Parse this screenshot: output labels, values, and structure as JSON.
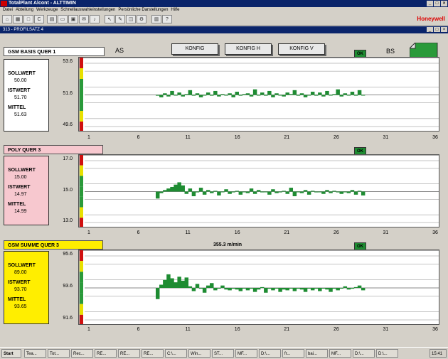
{
  "window": {
    "title": "TotalPlant Alcont - ALTTIMIN",
    "brand": "Honeywell"
  },
  "menu": [
    "Datei",
    "Abteilung",
    "Werkzeuge",
    "Schnellauswahleinstellungen",
    "Persönliche Darstellungen",
    "Hilfe"
  ],
  "subwindow": {
    "title": "313 - PROFILSATZ 4"
  },
  "header": {
    "as": "AS",
    "bs": "BS",
    "konfig": "KONFIG",
    "konfig_h": "KONFIG H",
    "konfig_v": "KONFIG V"
  },
  "panels": [
    {
      "title": "GSM BASIS QUER  1",
      "sollwert_label": "SOLLWERT",
      "sollwert": "50.00",
      "istwert_label": "ISTWERT",
      "istwert": "51.70",
      "mittel_label": "MITTEL",
      "mittel": "51.63",
      "ok": "OK",
      "y_top": "53.6",
      "y_mid": "51.6",
      "y_bot": "49.6",
      "x_ticks": [
        "1",
        "6",
        "11",
        "16",
        "21",
        "26",
        "31",
        "36"
      ],
      "center": 51.6,
      "half_range": 2.0,
      "values": [
        51.55,
        51.45,
        51.7,
        51.5,
        51.85,
        51.6,
        51.75,
        51.5,
        51.65,
        51.9,
        51.55,
        51.7,
        51.45,
        51.6,
        51.75,
        51.55,
        51.85,
        51.5,
        51.65,
        51.6,
        51.7,
        51.45,
        51.8,
        51.55,
        51.65,
        51.7,
        51.5,
        51.95,
        51.6,
        51.75,
        51.55,
        51.85,
        51.45,
        51.7,
        51.6,
        51.5,
        51.75,
        51.65,
        51.9,
        51.55,
        51.7,
        51.45,
        51.6,
        51.8,
        51.55,
        51.75,
        51.5,
        51.85,
        51.6,
        51.65,
        51.95,
        51.5,
        51.7,
        51.6,
        51.8,
        51.55,
        51.9,
        51.6
      ]
    },
    {
      "title": "POLY    QUER  3",
      "sollwert_label": "SOLLWERT",
      "sollwert": "15.00",
      "istwert_label": "ISTWERT",
      "istwert": "14.97",
      "mittel_label": "MITTEL",
      "mittel": "14.99",
      "ok": "OK",
      "y_top": "17.0",
      "y_mid": "15.0",
      "y_bot": "13.0",
      "x_ticks": [
        "1",
        "6",
        "11",
        "16",
        "21",
        "26",
        "31",
        "36"
      ],
      "center": 15.0,
      "half_range": 2.0,
      "values": [
        14.55,
        14.9,
        15.1,
        15.2,
        15.3,
        15.45,
        15.6,
        15.4,
        14.85,
        15.2,
        14.7,
        14.95,
        15.25,
        14.8,
        15.1,
        14.9,
        15.05,
        14.75,
        15.0,
        15.15,
        14.85,
        14.95,
        15.05,
        14.8,
        15.0,
        14.9,
        15.2,
        14.85,
        15.1,
        14.95,
        15.0,
        14.8,
        15.15,
        14.9,
        14.95,
        15.05,
        14.85,
        15.25,
        14.7,
        15.0,
        14.9,
        15.1,
        14.8,
        15.05,
        14.95,
        15.0,
        14.85,
        15.1,
        14.9,
        15.05,
        14.95,
        14.85,
        15.0,
        14.9,
        15.1,
        14.8,
        15.05,
        14.75
      ]
    },
    {
      "title": "GSM SUMME QUER  3",
      "sollwert_label": "SOLLWERT",
      "sollwert": "89.00",
      "istwert_label": "ISTWERT",
      "istwert": "93.70",
      "mittel_label": "MITTEL",
      "mittel": "93.65",
      "ok": "OK",
      "speed": "355.3 m/min",
      "y_top": "95.6",
      "y_mid": "93.6",
      "y_bot": "91.6",
      "x_ticks": [
        "1",
        "6",
        "11",
        "16",
        "21",
        "26",
        "31",
        "36"
      ],
      "center": 93.6,
      "half_range": 2.0,
      "values": [
        92.9,
        93.8,
        94.1,
        94.45,
        94.2,
        93.95,
        94.3,
        94.05,
        94.25,
        93.7,
        93.4,
        93.85,
        93.55,
        93.3,
        93.75,
        93.9,
        93.45,
        93.6,
        93.75,
        93.5,
        93.45,
        93.55,
        93.5,
        93.4,
        93.6,
        93.45,
        93.55,
        93.35,
        93.5,
        93.65,
        93.3,
        93.55,
        93.45,
        93.6,
        93.35,
        93.5,
        93.45,
        93.6,
        93.4,
        93.55,
        93.5,
        93.35,
        93.6,
        93.45,
        93.55,
        93.4,
        93.6,
        93.5,
        93.35,
        93.55,
        93.45,
        93.6,
        93.7,
        93.5,
        93.55,
        93.65,
        93.75,
        93.45
      ]
    }
  ],
  "taskbar": {
    "start": "Start",
    "items": [
      "Tea...",
      "Tot...",
      "Rec...",
      "RE...",
      "RE...",
      "RE...",
      "C:\\...",
      "Win...",
      "ST...",
      "MF...",
      "D:\\...",
      "fr...",
      "bai...",
      "MF...",
      "D:\\...",
      "D:\\..."
    ],
    "clock": "15:41"
  },
  "colors": {
    "data_green": "#1e8c32",
    "poly_pink": "#f7c8cf",
    "summe_yellow": "#ffee00",
    "marker_red": "#d01010",
    "marker_yellow": "#e8e000",
    "marker_green": "#2a9a3a"
  }
}
